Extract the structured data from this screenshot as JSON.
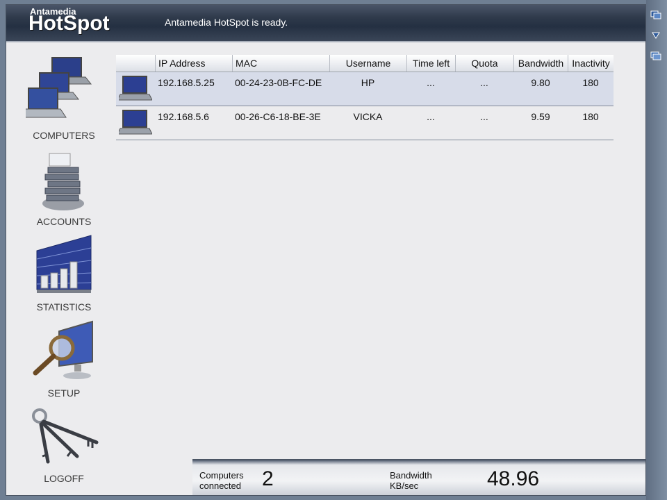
{
  "header": {
    "brand_small": "Antamedia",
    "brand_big": "HotSpot",
    "status": "Antamedia HotSpot is ready."
  },
  "sidebar": {
    "items": [
      {
        "label": "COMPUTERS",
        "icon": "computers-icon"
      },
      {
        "label": "ACCOUNTS",
        "icon": "accounts-icon"
      },
      {
        "label": "STATISTICS",
        "icon": "statistics-icon"
      },
      {
        "label": "SETUP",
        "icon": "setup-icon"
      },
      {
        "label": "LOGOFF",
        "icon": "logoff-icon"
      }
    ]
  },
  "table": {
    "columns": [
      "IP Address",
      "MAC",
      "Username",
      "Time left",
      "Quota",
      "Bandwidth",
      "Inactivity"
    ],
    "rows": [
      {
        "ip": "192.168.5.25",
        "mac": "00-24-23-0B-FC-DE",
        "username": "HP",
        "time_left": "...",
        "quota": "...",
        "bandwidth": "9.80",
        "inactivity": "180",
        "selected": true
      },
      {
        "ip": "192.168.5.6",
        "mac": "00-26-C6-18-BE-3E",
        "username": "VICKA",
        "time_left": "...",
        "quota": "...",
        "bandwidth": "9.59",
        "inactivity": "180",
        "selected": false
      }
    ]
  },
  "footer": {
    "computers_label_1": "Computers",
    "computers_label_2": "connected",
    "computers_count": "2",
    "bandwidth_label_1": "Bandwidth",
    "bandwidth_label_2": "KB/sec",
    "bandwidth_value": "48.96"
  },
  "colors": {
    "header_bg": "#2f3a4b",
    "selected_row": "#d7dce9",
    "body_bg": "#ececee"
  }
}
